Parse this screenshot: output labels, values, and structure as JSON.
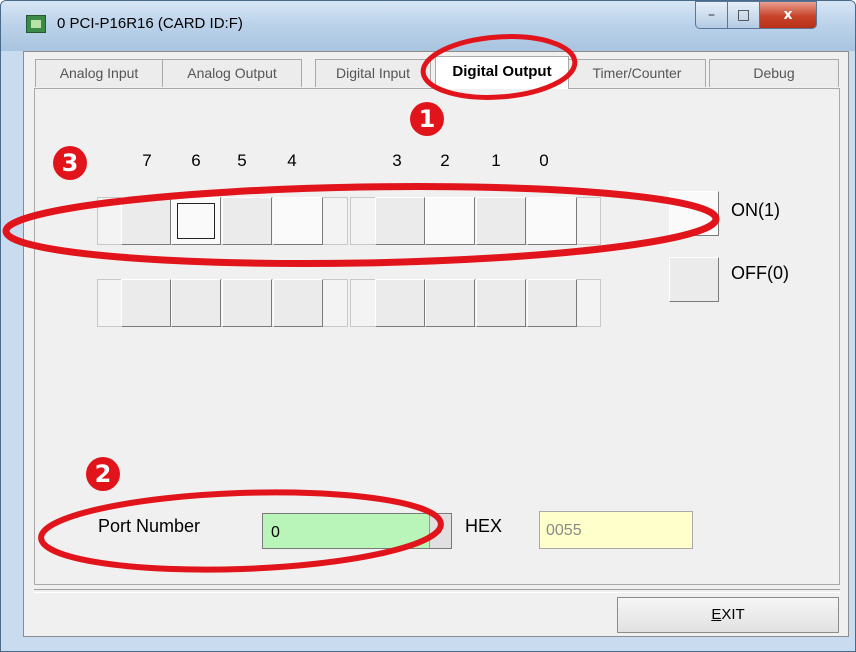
{
  "window": {
    "title": "0 PCI-P16R16 (CARD ID:F)"
  },
  "caption_buttons": {
    "minimize": "–",
    "maximize": "□",
    "close": "x"
  },
  "tabs": [
    {
      "label": "Analog Input",
      "selected": false
    },
    {
      "label": "Analog Output",
      "selected": false
    },
    {
      "label": "Digital Input",
      "selected": false
    },
    {
      "label": "Digital Output",
      "selected": true
    },
    {
      "label": "Timer/Counter",
      "selected": false
    },
    {
      "label": "Debug",
      "selected": false
    }
  ],
  "bit_labels": [
    "7",
    "6",
    "5",
    "4",
    "3",
    "2",
    "1",
    "0"
  ],
  "legend": {
    "on_label": "ON(1)",
    "off_label": "OFF(0)"
  },
  "port": {
    "label": "Port Number",
    "value": "0",
    "hex_label": "HEX",
    "hex_value": "0055"
  },
  "exit_button": {
    "accel": "E",
    "rest": "XIT"
  },
  "callouts": {
    "one": "1",
    "two": "2",
    "three": "3"
  },
  "colors": {
    "annotation_red": "#e2141b",
    "port_field_bg": "#b9f5b9",
    "hex_field_bg": "#ffffcc"
  },
  "bit_states_upper_row": [
    "off",
    "off",
    "off",
    "on",
    "off",
    "on",
    "off",
    "on"
  ]
}
